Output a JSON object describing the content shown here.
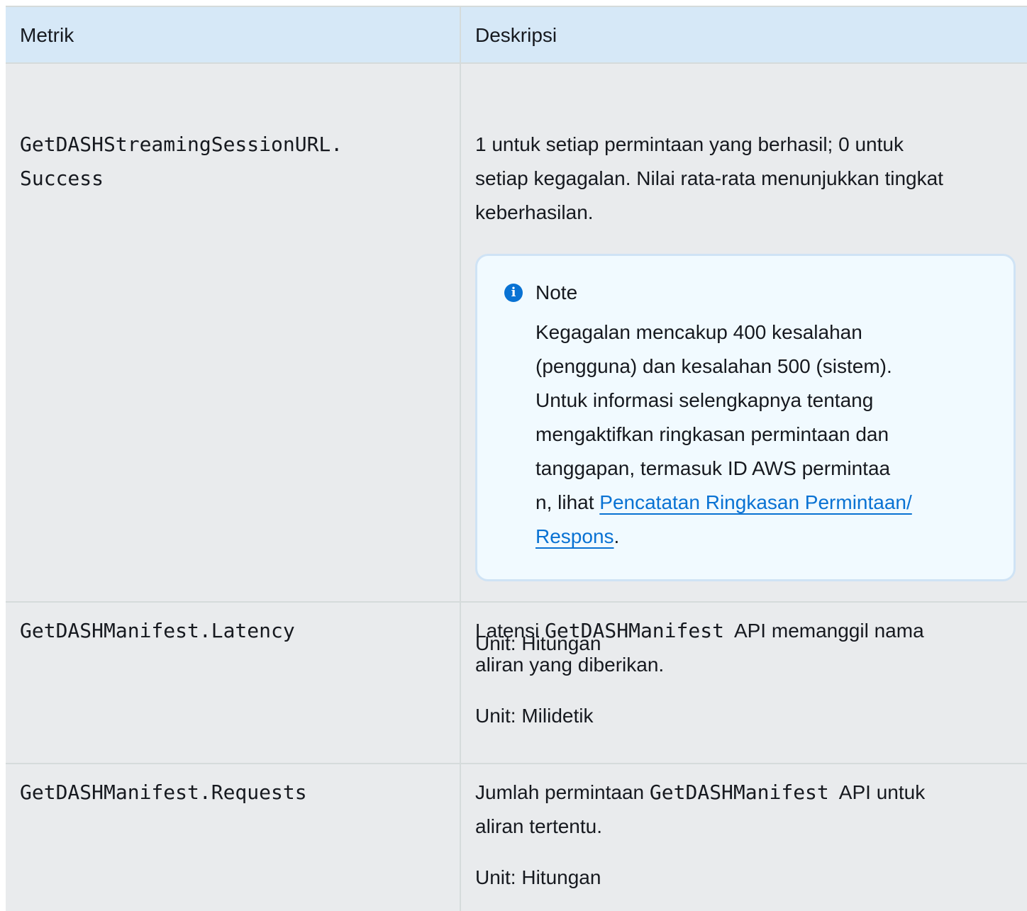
{
  "table": {
    "headers": {
      "metric": "Metrik",
      "description": "Deskripsi"
    },
    "rows": [
      {
        "metric_line1": "GetDASHStreamingSessionURL.",
        "metric_line2": "Success",
        "desc_line1": "1 untuk setiap permintaan yang berhasil; 0 untuk",
        "desc_line2": "setiap kegagalan. Nilai rata-rata menunjukkan tingkat",
        "desc_line3": "keberhasilan.",
        "note": {
          "title": "Note",
          "icon": "info-icon",
          "line1": "Kegagalan mencakup 400 kesalahan",
          "line2": "(pengguna) dan kesalahan 500 (sistem).",
          "line3": "Untuk informasi selengkapnya tentang",
          "line4": "mengaktifkan ringkasan permintaan dan",
          "line5": "tanggapan, termasuk ID AWS permintaa",
          "line6_prefix": "n, lihat ",
          "link_part1": "Pencatatan Ringkasan Permintaan/",
          "link_part2": "Respons",
          "line7_suffix": "."
        },
        "unit": "Unit: Hitungan"
      },
      {
        "metric": "GetDASHManifest.Latency",
        "desc_prefix": "Latensi ",
        "desc_code": "GetDASHManifest",
        "desc_suffix": "API memanggil nama",
        "desc_line2": "aliran yang diberikan.",
        "unit": "Unit: Milidetik"
      },
      {
        "metric": "GetDASHManifest.Requests",
        "desc_prefix": "Jumlah permintaan ",
        "desc_code": "GetDASHManifest",
        "desc_suffix": "API untuk",
        "desc_line2": "aliran tertentu.",
        "unit": "Unit: Hitungan"
      }
    ]
  },
  "colors": {
    "header_bg": "#d6e8f7",
    "row_bg": "#e9ebed",
    "note_bg": "#f1faff",
    "link": "#0972d3"
  }
}
